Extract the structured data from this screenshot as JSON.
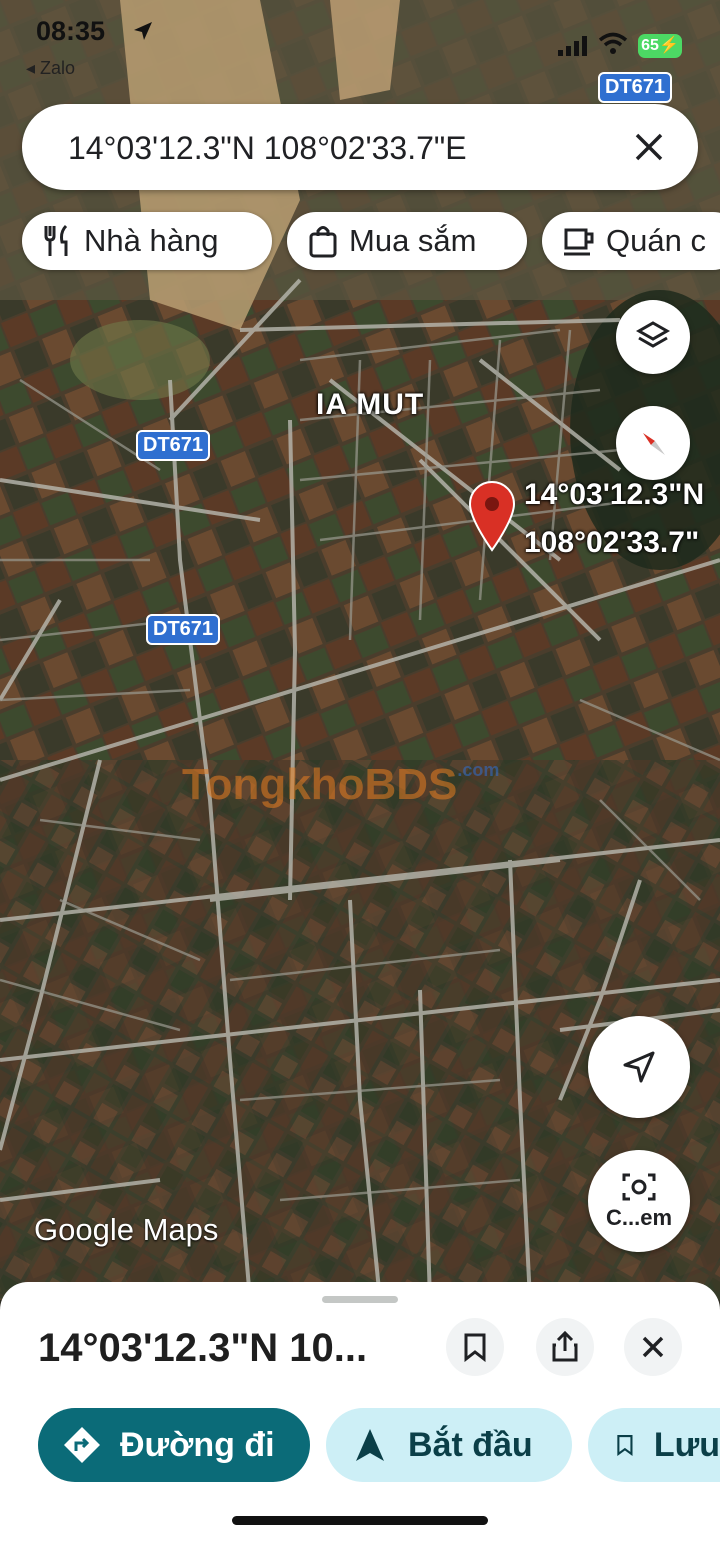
{
  "status_bar": {
    "time": "08:35",
    "back_app": "Zalo",
    "battery": "65"
  },
  "search": {
    "query": "14°03'12.3\"N 108°02'33.7\"E"
  },
  "chips": [
    {
      "label": "Nhà hàng",
      "icon": "fork-knife-icon"
    },
    {
      "label": "Mua sắm",
      "icon": "shopping-bag-icon"
    },
    {
      "label": "Quán c",
      "icon": "coffee-cup-icon"
    }
  ],
  "map": {
    "place_label": "IA MUT",
    "road_labels": [
      "DT671",
      "DT671",
      "DT671"
    ],
    "pin_label_line1": "14°03'12.3\"N",
    "pin_label_line2": "108°02'33.7\"",
    "watermark": "TongkhoBDS",
    "watermark_suffix": ".com",
    "attribution": "Google Maps",
    "camera_button_label": "C...em",
    "pin_color": "#d93025"
  },
  "sheet": {
    "title": "14°03'12.3\"N 10...",
    "actions": [
      {
        "label": "Đường đi",
        "icon": "directions-icon"
      },
      {
        "label": "Bắt đầu",
        "icon": "navigation-arrow-icon"
      },
      {
        "label": "Lưu",
        "icon": "bookmark-icon"
      }
    ]
  },
  "colors": {
    "accent": "#0b6b78",
    "tonal": "#cdeff6"
  }
}
